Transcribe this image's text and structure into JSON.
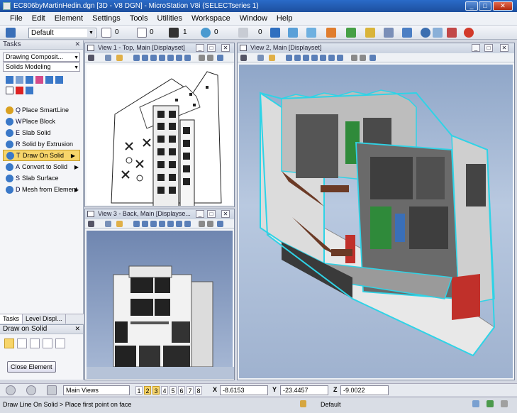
{
  "window": {
    "title": "EC806byMartinHedin.dgn [3D - V8 DGN] - MicroStation V8i (SELECTseries 1)",
    "min": "_",
    "max": "□",
    "close": "✕"
  },
  "menu": [
    "File",
    "Edit",
    "Element",
    "Settings",
    "Tools",
    "Utilities",
    "Workspace",
    "Window",
    "Help"
  ],
  "toolbar": {
    "level": "Default",
    "color_value": "0",
    "style_value": "0",
    "weight_value": "1",
    "class_value": "0",
    "transparency_value": "0"
  },
  "tasks": {
    "title": "Tasks",
    "close": "✕",
    "group": "Drawing Composit...",
    "subgroup": "Solids Modeling",
    "items": [
      {
        "key": "Q",
        "label": "Place SmartLine",
        "color": "#d9a020"
      },
      {
        "key": "W",
        "label": "Place Block",
        "color": "#3a78c8"
      },
      {
        "key": "E",
        "label": "Slab Solid",
        "color": "#3a78c8"
      },
      {
        "key": "R",
        "label": "Solid by Extrusion",
        "color": "#3a78c8"
      },
      {
        "key": "T",
        "label": "Draw On Solid",
        "color": "#3a78c8"
      },
      {
        "key": "A",
        "label": "Convert to Solid",
        "color": "#3a78c8"
      },
      {
        "key": "S",
        "label": "Slab Surface",
        "color": "#3a78c8"
      },
      {
        "key": "D",
        "label": "Mesh from Element",
        "color": "#3a78c8"
      }
    ],
    "active_item": "Draw On Solid",
    "tabs": [
      "Tasks",
      "Level Displ..."
    ]
  },
  "draw_on_solid": {
    "title": "Draw on Solid",
    "close": "✕",
    "close_button": "Close Element"
  },
  "views": {
    "view1": {
      "title": "View 1 - Top, Main [Displayset]"
    },
    "view2": {
      "title": "View 2, Main [Displayset]"
    },
    "view3": {
      "title": "View 3 - Back, Main [Displayse..."
    }
  },
  "coords": {
    "view_set": "Main Views",
    "view_numbers": [
      "1",
      "2",
      "3",
      "4",
      "5",
      "6",
      "7",
      "8"
    ],
    "active_views": [
      "2",
      "3"
    ],
    "x_label": "X",
    "x_value": "-8.6153",
    "y_label": "Y",
    "y_value": "-23.4457",
    "z_label": "Z",
    "z_value": "-9.0022"
  },
  "status": {
    "message": "Draw Line On Solid > Place first point on face",
    "level": "Default"
  },
  "colors": {
    "accent": "#f7d56a",
    "selection": "#2fd3e6",
    "sky": "#9fb2cf"
  }
}
